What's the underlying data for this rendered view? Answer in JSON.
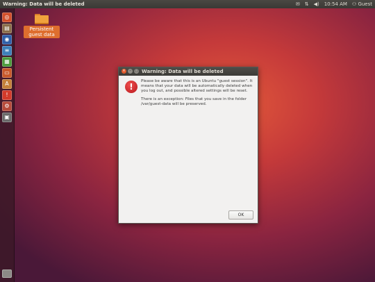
{
  "top_panel": {
    "window_title": "Warning: Data will be deleted",
    "indicators": [
      {
        "icon": "mail-icon",
        "glyph": "✉"
      },
      {
        "icon": "network-icon",
        "glyph": "⇅"
      },
      {
        "icon": "volume-icon",
        "glyph": "◀)"
      },
      {
        "icon": "clock",
        "text": "10:54 AM"
      },
      {
        "icon": "user-icon",
        "text": "Guest"
      }
    ],
    "clock": "10:54 AM",
    "user": "Guest"
  },
  "launcher": {
    "items": [
      {
        "name": "dash-home",
        "glyph": "◎",
        "color": "#d34f2a"
      },
      {
        "name": "files",
        "glyph": "▤",
        "color": "#8a6d4a"
      },
      {
        "name": "firefox",
        "glyph": "◉",
        "color": "#2f5fa8"
      },
      {
        "name": "writer",
        "glyph": "≡",
        "color": "#3d7fb8"
      },
      {
        "name": "calc",
        "glyph": "▦",
        "color": "#4b9b3c"
      },
      {
        "name": "impress",
        "glyph": "▭",
        "color": "#c8582a"
      },
      {
        "name": "software-center",
        "glyph": "A",
        "color": "#c4803a"
      },
      {
        "name": "update-warning",
        "glyph": "!",
        "color": "#d33a2a"
      },
      {
        "name": "settings",
        "glyph": "⚙",
        "color": "#b74a3a"
      },
      {
        "name": "workspaces",
        "glyph": "▣",
        "color": "#6a6a6a"
      }
    ]
  },
  "desktop": {
    "folder_label": "Persistent guest data"
  },
  "dialog": {
    "title": "Warning: Data will be deleted",
    "paragraph1": "Please be aware that this is an Ubuntu \"guest session\". It means that your data will be automatically deleted when you log out, and possible altered settings will be reset.",
    "paragraph2": "There is an exception: Files that you save in the folder /var/guest-data will be preserved.",
    "ok_label": "OK",
    "close_glyph": "×",
    "min_glyph": "–",
    "max_glyph": "□"
  }
}
